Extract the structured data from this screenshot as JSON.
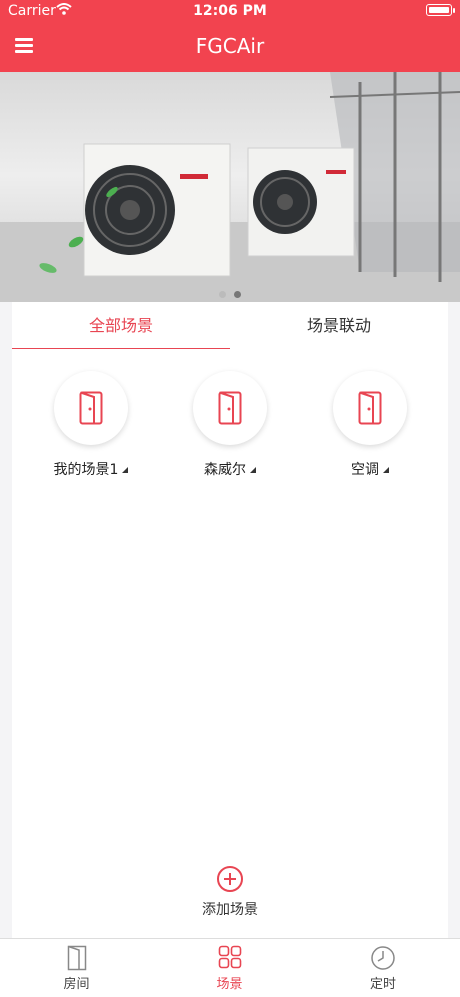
{
  "status_bar": {
    "carrier": "Carrier",
    "time": "12:06 PM"
  },
  "header": {
    "title": "FGCAir"
  },
  "banner": {
    "slides": 2,
    "active_slide": 1,
    "brand_text": "FUJITSU"
  },
  "tabs": {
    "scenes": "全部场景",
    "linkage": "场景联动",
    "active": "scenes"
  },
  "scenes": [
    {
      "label": "我的场景1"
    },
    {
      "label": "森威尔"
    },
    {
      "label": "空调"
    }
  ],
  "add_scene": {
    "label": "添加场景"
  },
  "tabbar": {
    "rooms": "房间",
    "scenes": "场景",
    "timer": "定时",
    "active": "scenes"
  },
  "colors": {
    "accent": "#f2434f",
    "accent_text": "#e84552"
  },
  "icons": {
    "menu": "menu-icon",
    "scene": "door-icon",
    "add": "plus-circle-icon",
    "rooms": "door-icon",
    "scenes": "grid-icon",
    "timer": "clock-icon"
  }
}
